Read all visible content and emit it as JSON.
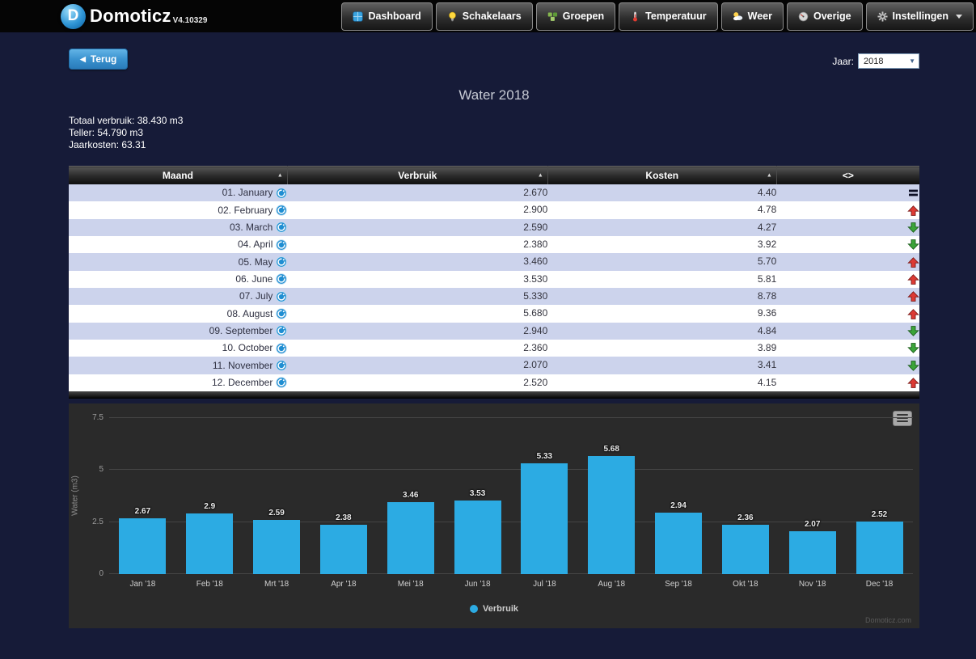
{
  "app": {
    "name": "Domoticz",
    "version": "V4.10329",
    "logo_letter": "D"
  },
  "nav": {
    "items": [
      {
        "label": "Dashboard",
        "icon": "dashboard-icon"
      },
      {
        "label": "Schakelaars",
        "icon": "lightbulb-icon"
      },
      {
        "label": "Groepen",
        "icon": "groups-icon"
      },
      {
        "label": "Temperatuur",
        "icon": "thermometer-icon"
      },
      {
        "label": "Weer",
        "icon": "weather-icon"
      },
      {
        "label": "Overige",
        "icon": "utility-meter-icon"
      },
      {
        "label": "Instellingen",
        "icon": "gear-icon"
      }
    ]
  },
  "toolbar": {
    "back_label": "Terug",
    "year_label": "Jaar:",
    "year_value": "2018"
  },
  "page": {
    "title": "Water 2018",
    "stats": [
      "Totaal verbruik: 38.430 m3",
      "Teller: 54.790 m3",
      "Jaarkosten: 63.31"
    ]
  },
  "table": {
    "headers": [
      "Maand",
      "Verbruik",
      "Kosten",
      "<>"
    ],
    "sort_arrow": "▲",
    "rows": [
      {
        "maand": "01. January",
        "verbruik": "2.670",
        "kosten": "4.40",
        "trend": "equal"
      },
      {
        "maand": "02. February",
        "verbruik": "2.900",
        "kosten": "4.78",
        "trend": "up"
      },
      {
        "maand": "03. March",
        "verbruik": "2.590",
        "kosten": "4.27",
        "trend": "down"
      },
      {
        "maand": "04. April",
        "verbruik": "2.380",
        "kosten": "3.92",
        "trend": "down"
      },
      {
        "maand": "05. May",
        "verbruik": "3.460",
        "kosten": "5.70",
        "trend": "up"
      },
      {
        "maand": "06. June",
        "verbruik": "3.530",
        "kosten": "5.81",
        "trend": "up"
      },
      {
        "maand": "07. July",
        "verbruik": "5.330",
        "kosten": "8.78",
        "trend": "up"
      },
      {
        "maand": "08. August",
        "verbruik": "5.680",
        "kosten": "9.36",
        "trend": "up"
      },
      {
        "maand": "09. September",
        "verbruik": "2.940",
        "kosten": "4.84",
        "trend": "down"
      },
      {
        "maand": "10. October",
        "verbruik": "2.360",
        "kosten": "3.89",
        "trend": "down"
      },
      {
        "maand": "11. November",
        "verbruik": "2.070",
        "kosten": "3.41",
        "trend": "down"
      },
      {
        "maand": "12. December",
        "verbruik": "2.520",
        "kosten": "4.15",
        "trend": "up"
      }
    ]
  },
  "chart_data": {
    "type": "bar",
    "title": "",
    "xlabel": "",
    "ylabel": "Water (m3)",
    "ylim": [
      0,
      7.5
    ],
    "yticks": [
      "0",
      "2.5",
      "5",
      "7.5"
    ],
    "grid": true,
    "legend_position": "bottom",
    "categories": [
      "Jan '18",
      "Feb '18",
      "Mrt '18",
      "Apr '18",
      "Mei '18",
      "Jun '18",
      "Jul '18",
      "Aug '18",
      "Sep '18",
      "Okt '18",
      "Nov '18",
      "Dec '18"
    ],
    "series": [
      {
        "name": "Verbruik",
        "color": "#2cabe3",
        "values": [
          2.67,
          2.9,
          2.59,
          2.38,
          3.46,
          3.53,
          5.33,
          5.68,
          2.94,
          2.36,
          2.07,
          2.52
        ],
        "labels": [
          "2.67",
          "2.9",
          "2.59",
          "2.38",
          "3.46",
          "3.53",
          "5.33",
          "5.68",
          "2.94",
          "2.36",
          "2.07",
          "2.52"
        ]
      }
    ],
    "watermark": "Domoticz.com"
  }
}
